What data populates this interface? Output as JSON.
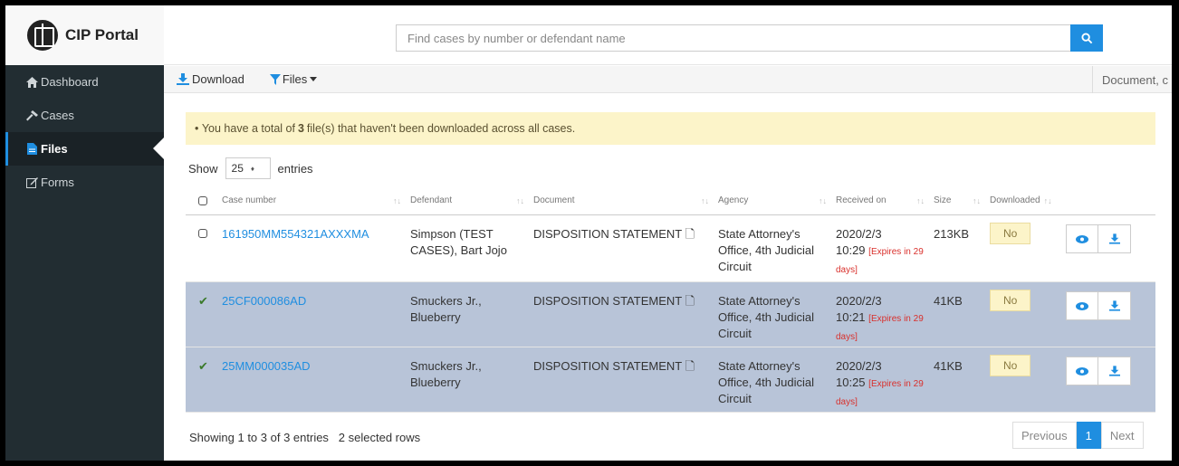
{
  "app": {
    "title": "CIP Portal"
  },
  "search": {
    "placeholder": "Find cases by number or defendant name"
  },
  "sidebar": {
    "items": [
      {
        "label": "Dashboard",
        "icon": "home-icon",
        "active": false
      },
      {
        "label": "Cases",
        "icon": "gavel-icon",
        "active": false
      },
      {
        "label": "Files",
        "icon": "file-icon",
        "active": true
      },
      {
        "label": "Forms",
        "icon": "edit-icon",
        "active": false
      }
    ]
  },
  "toolbar": {
    "download_label": "Download",
    "files_label": "Files",
    "right_label": "Document, c"
  },
  "alert": {
    "prefix": "You have a total of",
    "count": "3",
    "suffix": "file(s) that haven't been downloaded across all cases."
  },
  "entries": {
    "show_label": "Show",
    "value": "25",
    "entries_label": "entries"
  },
  "table": {
    "headers": [
      "Case number",
      "Defendant",
      "Document",
      "Agency",
      "Received on",
      "Size",
      "Downloaded"
    ],
    "rows": [
      {
        "case": "161950MM554321AXXXMA",
        "defendant": "Simpson (TEST CASES), Bart Jojo",
        "document": "DISPOSITION STATEMENT",
        "agency": "State Attorney's Office, 4th Judicial Circuit",
        "date": "2020/2/3",
        "time": "10:29",
        "expires": "[Expires in 29 days]",
        "size": "213KB",
        "downloaded": "No",
        "selected": false
      },
      {
        "case": "25CF000086AD",
        "defendant": "Smuckers Jr., Blueberry",
        "document": "DISPOSITION STATEMENT",
        "agency": "State Attorney's Office, 4th Judicial Circuit",
        "date": "2020/2/3",
        "time": "10:21",
        "expires": "[Expires in 29 days]",
        "size": "41KB",
        "downloaded": "No",
        "selected": true
      },
      {
        "case": "25MM000035AD",
        "defendant": "Smuckers Jr., Blueberry",
        "document": "DISPOSITION STATEMENT",
        "agency": "State Attorney's Office, 4th Judicial Circuit",
        "date": "2020/2/3",
        "time": "10:25",
        "expires": "[Expires in 29 days]",
        "size": "41KB",
        "downloaded": "No",
        "selected": true
      }
    ]
  },
  "footer": {
    "info": "Showing 1 to 3 of 3 entries",
    "selected": "2 selected rows"
  },
  "pager": {
    "previous": "Previous",
    "page": "1",
    "next": "Next"
  },
  "colors": {
    "accent": "#1f8ee0",
    "sidebar": "#222d32",
    "selected_row": "#b8c4d8",
    "alert_bg": "#fcf4c9"
  }
}
